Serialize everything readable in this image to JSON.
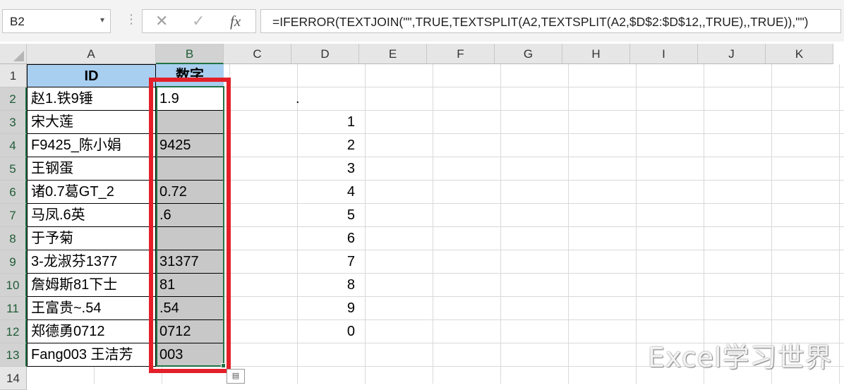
{
  "formula_bar": {
    "name_box": "B2",
    "name_box_dropdown": "▾",
    "grip": "⋮",
    "cancel_symbol": "✕",
    "enter_symbol": "✓",
    "fx_label": "fx",
    "formula": "=IFERROR(TEXTJOIN(\"\",TRUE,TEXTSPLIT(A2,TEXTSPLIT(A2,$D$2:$D$12,,TRUE),,TRUE)),\"\")"
  },
  "columns": [
    "A",
    "B",
    "C",
    "D",
    "E",
    "F",
    "G",
    "H",
    "I",
    "J",
    "K"
  ],
  "rows": [
    "1",
    "2",
    "3",
    "4",
    "5",
    "6",
    "7",
    "8",
    "9",
    "10",
    "11",
    "12",
    "13",
    "14"
  ],
  "table": {
    "header_id": "ID",
    "header_number": "数字",
    "ids": [
      "赵1.铁9锤",
      "宋大莲",
      "F9425_陈小娟",
      "王钢蛋",
      "诸0.7葛GT_2",
      "马凤.6英",
      "于予菊",
      "3-龙淑芬1377",
      "詹姆斯81下士",
      "王富贵~.54",
      "郑德勇0712",
      "Fang003 王洁芳"
    ],
    "numbers": [
      "1.9",
      "",
      "9425",
      "",
      "0.72",
      ".6",
      "",
      "31377",
      "81",
      ".54",
      "0712",
      "003"
    ]
  },
  "delimiters": [
    ".",
    "1",
    "2",
    "3",
    "4",
    "5",
    "6",
    "7",
    "8",
    "9",
    "0"
  ],
  "selection": {
    "active_cell": "B2",
    "range": "B2:B13",
    "highlight_color": "#e3202a",
    "selection_color": "#217346"
  },
  "watermark": "Excel学习世界"
}
